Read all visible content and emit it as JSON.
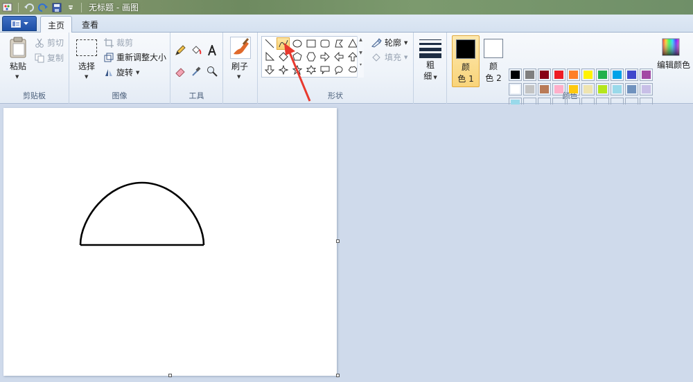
{
  "window": {
    "title": "无标题 - 画图"
  },
  "tabs": {
    "home": "主页",
    "view": "查看"
  },
  "clipboard": {
    "paste": "粘贴",
    "cut": "剪切",
    "copy": "复制",
    "group": "剪贴板"
  },
  "image": {
    "select": "选择",
    "crop": "裁剪",
    "resize": "重新调整大小",
    "rotate": "旋转",
    "group": "图像"
  },
  "tools": {
    "group": "工具"
  },
  "brushes": {
    "label": "刷子"
  },
  "shapes": {
    "group": "形状",
    "outline": "轮廓",
    "fill": "填充",
    "selected": "curve"
  },
  "size": {
    "label_1": "粗",
    "label_2": "细"
  },
  "colors": {
    "group": "颜色",
    "color1_label_1": "颜",
    "color1_label_2": "色 1",
    "color2_label_1": "颜",
    "color2_label_2": "色 2",
    "color1": "#000000",
    "color2": "#ffffff",
    "edit": "编辑颜色",
    "palette_row1": [
      "#000000",
      "#7f7f7f",
      "#880015",
      "#ed1c24",
      "#ff7f27",
      "#fff200",
      "#22b14c",
      "#00a2e8",
      "#3f48cc",
      "#a349a4"
    ],
    "palette_row2": [
      "#ffffff",
      "#c3c3c3",
      "#b97a57",
      "#ffaec9",
      "#ffc90e",
      "#efe4b0",
      "#b5e61d",
      "#99d9ea",
      "#7092be",
      "#c8bfe7"
    ],
    "palette_row3": [
      "#99d9ea",
      "",
      "",
      "",
      "",
      "",
      "",
      "",
      "",
      ""
    ]
  }
}
